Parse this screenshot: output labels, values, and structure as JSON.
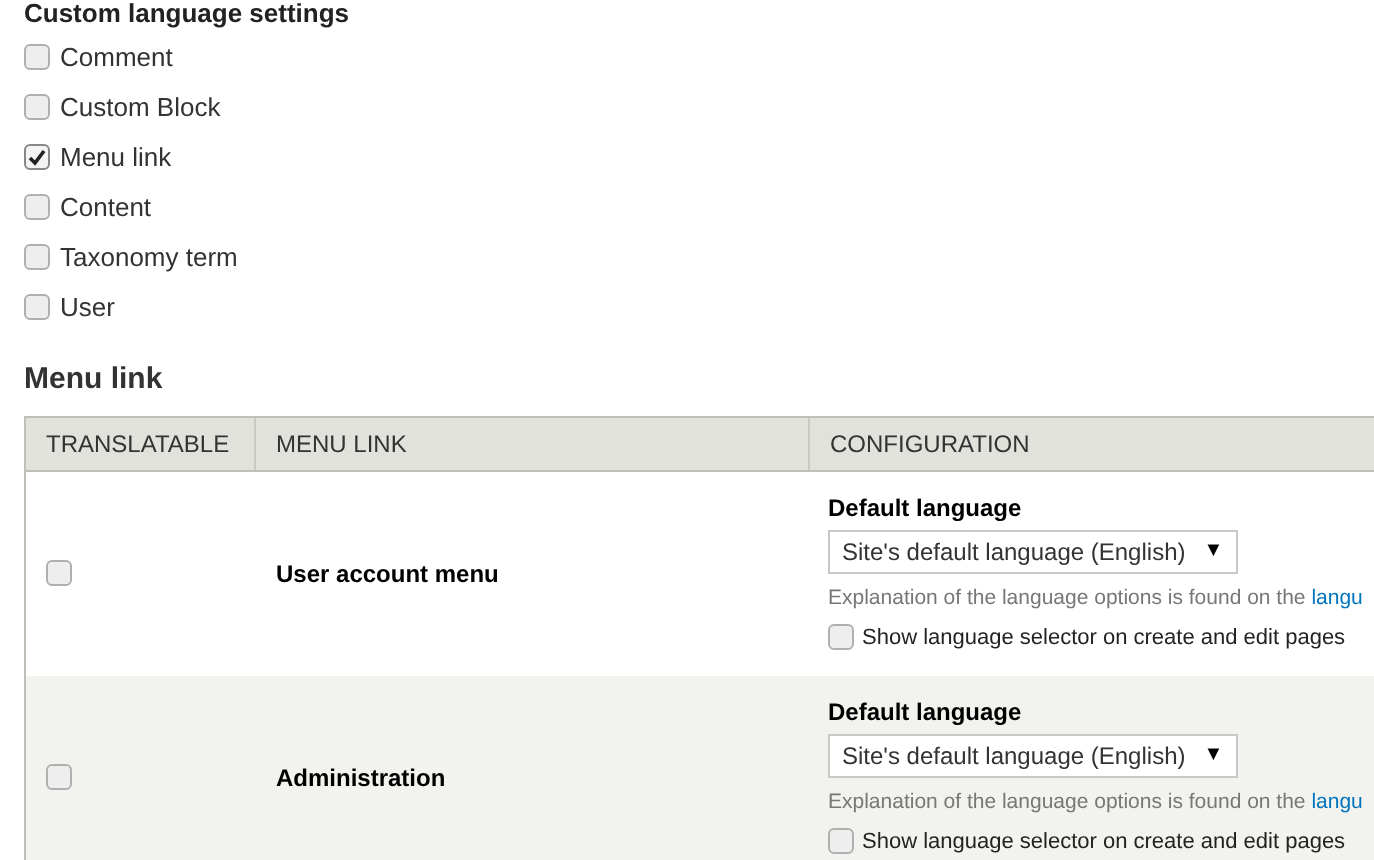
{
  "section_title": "Custom language settings",
  "entity_types": [
    {
      "label": "Comment",
      "checked": false
    },
    {
      "label": "Custom Block",
      "checked": false
    },
    {
      "label": "Menu link",
      "checked": true
    },
    {
      "label": "Content",
      "checked": false
    },
    {
      "label": "Taxonomy term",
      "checked": false
    },
    {
      "label": "User",
      "checked": false
    }
  ],
  "subsection_title": "Menu link",
  "table": {
    "columns": [
      "TRANSLATABLE",
      "MENU LINK",
      "CONFIGURATION"
    ],
    "rows": [
      {
        "translatable": false,
        "menu_link": "User account menu",
        "config": {
          "label": "Default language",
          "select": {
            "value": "Site's default language (English)",
            "caret": "▼"
          },
          "description": "Explanation of the language options is found on the ",
          "description_link": "langu",
          "selector_label": "Show language selector on create and edit pages",
          "selector_checked": false
        }
      },
      {
        "translatable": false,
        "menu_link": "Administration",
        "config": {
          "label": "Default language",
          "select": {
            "value": "Site's default language (English)",
            "caret": "▼"
          },
          "description": "Explanation of the language options is found on the ",
          "description_link": "langu",
          "selector_label": "Show language selector on create and edit pages",
          "selector_checked": false
        }
      }
    ]
  }
}
